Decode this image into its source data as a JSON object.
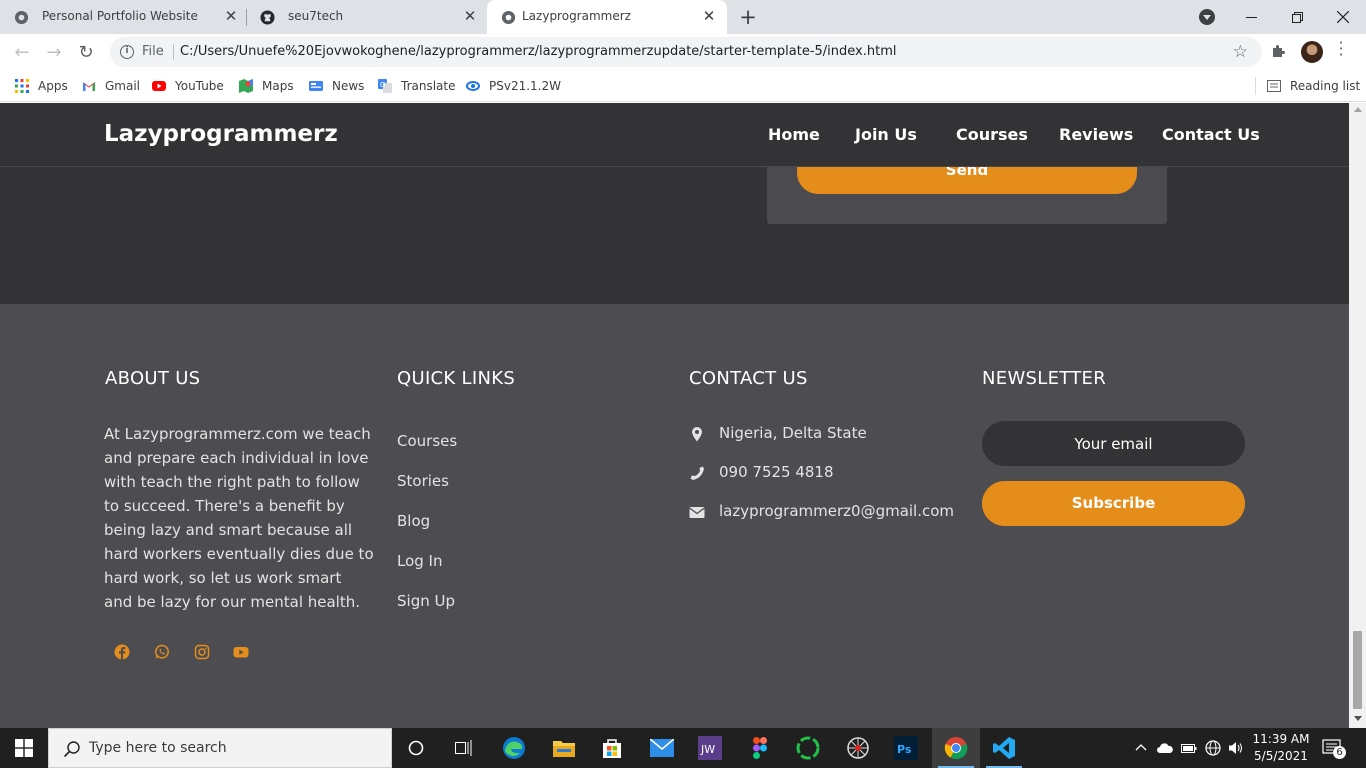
{
  "browser": {
    "tabs": [
      {
        "title": "Personal Portfolio Website",
        "active": false
      },
      {
        "title": "seu7tech",
        "active": false
      },
      {
        "title": "Lazyprogrammerz",
        "active": true
      }
    ],
    "address": {
      "scheme_label": "File",
      "url": "C:/Users/Unuefe%20Ejovwokoghene/lazyprogrammerz/lazyprogrammerzupdate/starter-template-5/index.html"
    },
    "bookmarks": [
      {
        "label": "Apps",
        "icon": "apps-grid-icon"
      },
      {
        "label": "Gmail",
        "icon": "gmail-icon"
      },
      {
        "label": "YouTube",
        "icon": "youtube-icon"
      },
      {
        "label": "Maps",
        "icon": "maps-icon"
      },
      {
        "label": "News",
        "icon": "news-icon"
      },
      {
        "label": "Translate",
        "icon": "translate-icon"
      },
      {
        "label": "PSv21.1.2W",
        "icon": "photoshop-express-icon"
      }
    ],
    "reading_list": "Reading list"
  },
  "site": {
    "brand": "Lazyprogrammerz",
    "nav": [
      "Home",
      "Join Us",
      "Courses",
      "Reviews",
      "Contact Us"
    ],
    "send_label": "Send",
    "accent_color": "#e58d1b",
    "dark_bg": "#333335",
    "footer_bg": "#4d4c50",
    "footer": {
      "about": {
        "heading": "ABOUT US",
        "text": "At Lazyprogrammerz.com we teach and prepare each individual in love with teach the right path to follow to succeed. There's a benefit by being lazy and smart because all hard workers eventually dies due to hard work, so let us work smart and be lazy for our mental health.",
        "social": [
          "facebook-icon",
          "whatsapp-icon",
          "instagram-icon",
          "youtube-icon"
        ]
      },
      "quick_links": {
        "heading": "QUICK LINKS",
        "items": [
          "Courses",
          "Stories",
          "Blog",
          "Log In",
          "Sign Up"
        ]
      },
      "contact": {
        "heading": "CONTACT US",
        "location": "Nigeria, Delta State",
        "phone": "090 7525 4818",
        "email": "lazyprogrammerz0@gmail.com"
      },
      "newsletter": {
        "heading": "NEWSLETTER",
        "placeholder": "Your email",
        "button": "Subscribe"
      }
    }
  },
  "taskbar": {
    "search_placeholder": "Type here to search",
    "apps": [
      "task-view-icon",
      "edge-icon",
      "file-explorer-icon",
      "store-icon",
      "mail-icon",
      "jw-library-icon",
      "figma-icon",
      "spinner-app-icon",
      "spider-app-icon",
      "photoshop-icon",
      "chrome-icon",
      "vscode-icon"
    ],
    "time": "11:39 AM",
    "date": "5/5/2021",
    "notification_count": "6"
  }
}
